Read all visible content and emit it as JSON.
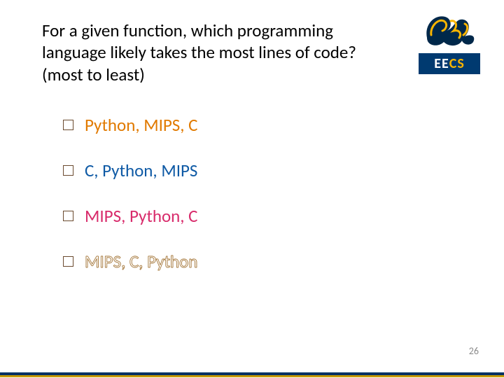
{
  "question": "For a given function, which programming language likely takes the most lines of code? (most to least)",
  "options": [
    {
      "text": "Python, MIPS, C",
      "class": "c-orange"
    },
    {
      "text": "C, Python, MIPS",
      "class": "c-blue"
    },
    {
      "text": "MIPS, Python, C",
      "class": "c-pink"
    },
    {
      "text": "MIPS, C, Python",
      "class": "c-outline"
    }
  ],
  "logo": {
    "ee": "EE",
    "cs": "CS"
  },
  "page_number": "26"
}
